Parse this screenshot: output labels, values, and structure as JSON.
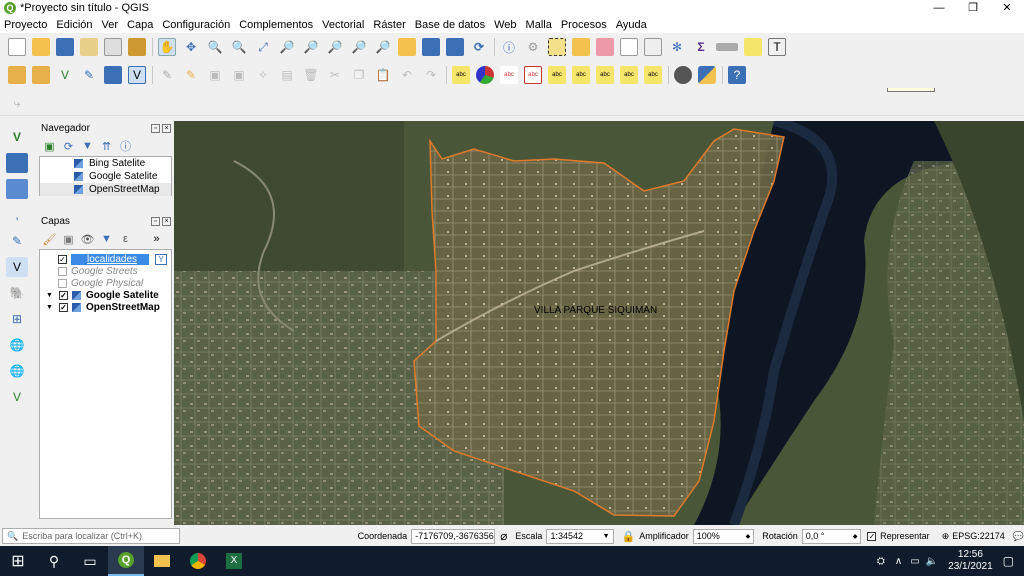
{
  "window": {
    "title": "*Proyecto sin título - QGIS",
    "minimize": "—",
    "restore": "❐",
    "close": "✕"
  },
  "menu": [
    "Proyecto",
    "Edición",
    "Ver",
    "Capa",
    "Configuración",
    "Complementos",
    "Vectorial",
    "Ráster",
    "Base de datos",
    "Web",
    "Malla",
    "Procesos",
    "Ayuda"
  ],
  "tooltip": "Vectorial",
  "navigator": {
    "title": "Navegador",
    "items": [
      "Bing Satelite",
      "Google Satelite",
      "OpenStreetMap"
    ]
  },
  "layers": {
    "title": "Capas",
    "items": [
      {
        "label": "localidades",
        "checked": true
      },
      {
        "label": "Google Streets",
        "checked": false
      },
      {
        "label": "Google Physical",
        "checked": false
      },
      {
        "label": "Google Satelite",
        "checked": true
      },
      {
        "label": "OpenStreetMap",
        "checked": true
      }
    ]
  },
  "map": {
    "label": "VILLA PARQUE SIQUIMAN",
    "polygon_color": "#e07a2a"
  },
  "status": {
    "locator_placeholder": "Escriba para localizar (Ctrl+K)",
    "coord_label": "Coordenada",
    "coord_value": "-7176709,-3676356",
    "scale_label": "Escala",
    "scale_value": "1:34542",
    "magnifier_label": "Amplificador",
    "magnifier_value": "100%",
    "rotation_label": "Rotación",
    "rotation_value": "0,0 °",
    "render_label": "Representar",
    "crs": "EPSG:22174"
  },
  "taskbar": {
    "time": "12:56",
    "date": "23/1/2021"
  }
}
